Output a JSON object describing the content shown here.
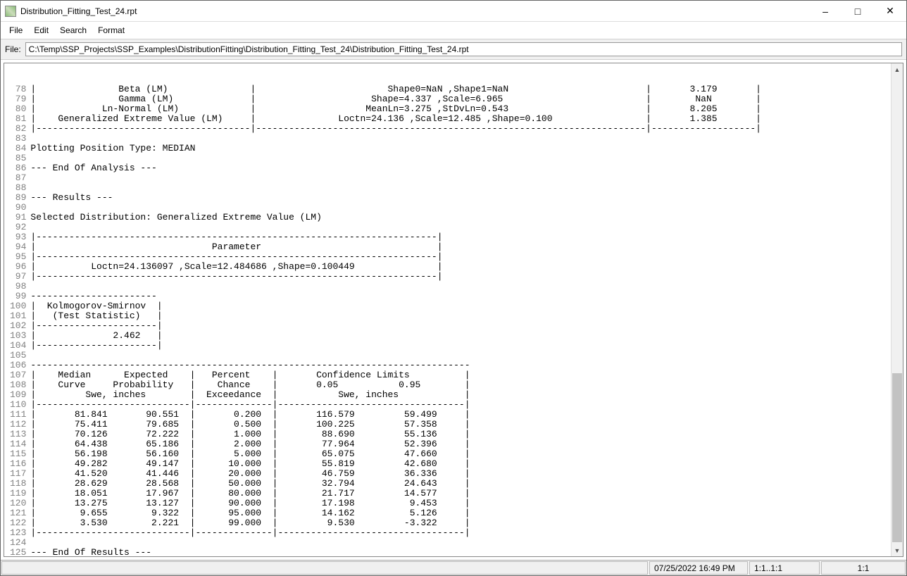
{
  "window": {
    "title": "Distribution_Fitting_Test_24.rpt"
  },
  "menu": {
    "file": "File",
    "edit": "Edit",
    "search": "Search",
    "format": "Format"
  },
  "filebar": {
    "label": "File:",
    "path": "C:\\Temp\\SSP_Projects\\SSP_Examples\\DistributionFitting\\Distribution_Fitting_Test_24\\Distribution_Fitting_Test_24.rpt"
  },
  "editor": {
    "first_line_no": 78,
    "lines": [
      "|               Beta (LM)               |                        Shape0=NaN ,Shape1=NaN                         |       3.179       |",
      "|               Gamma (LM)              |                     Shape=4.337 ,Scale=6.965                          |        NaN        |",
      "|            Ln-Normal (LM)             |                    MeanLn=3.275 ,StDvLn=0.543                         |       8.205       |",
      "|    Generalized Extreme Value (LM)     |               Loctn=24.136 ,Scale=12.485 ,Shape=0.100                 |       1.385       |",
      "|---------------------------------------|-----------------------------------------------------------------------|-------------------|",
      "",
      "Plotting Position Type: MEDIAN",
      "",
      "--- End Of Analysis ---",
      "",
      "",
      "--- Results ---",
      "",
      "Selected Distribution: Generalized Extreme Value (LM)",
      "",
      "|-------------------------------------------------------------------------|",
      "|                                Parameter                                |",
      "|-------------------------------------------------------------------------|",
      "|          Loctn=24.136097 ,Scale=12.484686 ,Shape=0.100449               |",
      "|-------------------------------------------------------------------------|",
      "",
      "-----------------------",
      "|  Kolmogorov-Smirnov  |",
      "|   (Test Statistic)   |",
      "|----------------------|",
      "|              2.462   |",
      "|----------------------|",
      "",
      "--------------------------------------------------------------------------------",
      "|    Median      Expected    |   Percent    |       Confidence Limits          |",
      "|    Curve     Probability   |    Chance    |       0.05           0.95        |",
      "|         Swe, inches        |  Exceedance  |           Swe, inches            |",
      "|----------------------------|--------------|----------------------------------|",
      "|       81.841       90.551  |       0.200  |       116.579         59.499     |",
      "|       75.411       79.685  |       0.500  |       100.225         57.358     |",
      "|       70.126       72.222  |       1.000  |        88.690         55.136     |",
      "|       64.438       65.186  |       2.000  |        77.964         52.396     |",
      "|       56.198       56.160  |       5.000  |        65.075         47.660     |",
      "|       49.282       49.147  |      10.000  |        55.819         42.680     |",
      "|       41.520       41.446  |      20.000  |        46.759         36.336     |",
      "|       28.629       28.568  |      50.000  |        32.794         24.643     |",
      "|       18.051       17.967  |      80.000  |        21.717         14.577     |",
      "|       13.275       13.127  |      90.000  |        17.198          9.453     |",
      "|        9.655        9.322  |      95.000  |        14.162          5.126     |",
      "|        3.530        2.221  |      99.000  |         9.530         -3.322     |",
      "|----------------------------|--------------|----------------------------------|",
      "",
      "--- End Of Results ---",
      ""
    ]
  },
  "status": {
    "datetime": "07/25/2022 16:49 PM",
    "pos": "1:1..1:1",
    "zoom": "1:1"
  }
}
